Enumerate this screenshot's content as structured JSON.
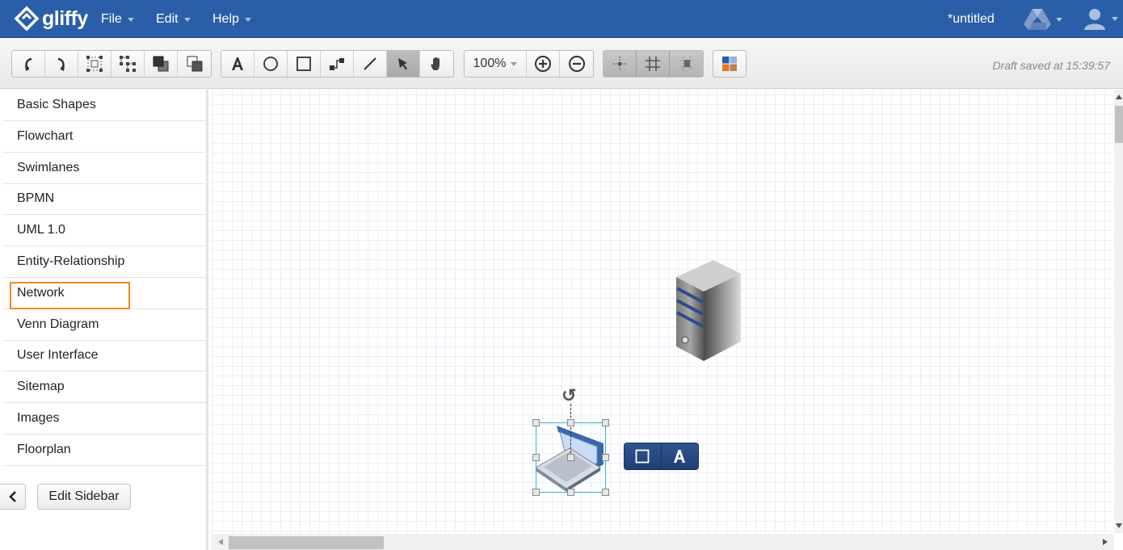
{
  "app": {
    "logo_text": "gliffy",
    "document_title": "*untitled"
  },
  "menus": [
    {
      "label": "File"
    },
    {
      "label": "Edit"
    },
    {
      "label": "Help"
    }
  ],
  "toolbar": {
    "zoom_value": "100%",
    "draft_status": "Draft saved at 15:39:57",
    "icons": {
      "undo": "undo-icon",
      "redo": "redo-icon",
      "group": "group-icon",
      "ungroup": "ungroup-icon",
      "bring_front": "bring-to-front-icon",
      "send_back": "send-to-back-icon",
      "text": "text-tool-icon",
      "ellipse": "ellipse-tool-icon",
      "rectangle": "rectangle-tool-icon",
      "connector": "connector-tool-icon",
      "line": "line-tool-icon",
      "pointer": "pointer-tool-icon",
      "pan": "pan-tool-icon",
      "zoom_in": "zoom-in-icon",
      "zoom_out": "zoom-out-icon",
      "snap": "snap-icon",
      "grid": "grid-icon",
      "guides": "guides-icon",
      "theme": "theme-icon"
    },
    "active_tool": "pointer"
  },
  "sidebar": {
    "items": [
      {
        "label": "Basic Shapes"
      },
      {
        "label": "Flowchart"
      },
      {
        "label": "Swimlanes"
      },
      {
        "label": "BPMN"
      },
      {
        "label": "UML 1.0"
      },
      {
        "label": "Entity-Relationship"
      },
      {
        "label": "Network"
      },
      {
        "label": "Venn Diagram"
      },
      {
        "label": "User Interface"
      },
      {
        "label": "Sitemap"
      },
      {
        "label": "Images"
      },
      {
        "label": "Floorplan"
      }
    ],
    "focused_item": "Network",
    "edit_button_label": "Edit Sidebar"
  },
  "canvas": {
    "shapes": [
      {
        "name": "server",
        "icon": "server-icon"
      },
      {
        "name": "laptop",
        "icon": "laptop-icon",
        "selected": true
      }
    ],
    "popup": {
      "shape_icon": "square-icon",
      "text_icon": "text-icon"
    },
    "rotate_glyph": "↺"
  },
  "colors": {
    "header_blue": "#2a5ea8",
    "focus_orange": "#ef8a1d",
    "selection_cyan": "#34b4d4",
    "popup_navy": "#234a85"
  }
}
